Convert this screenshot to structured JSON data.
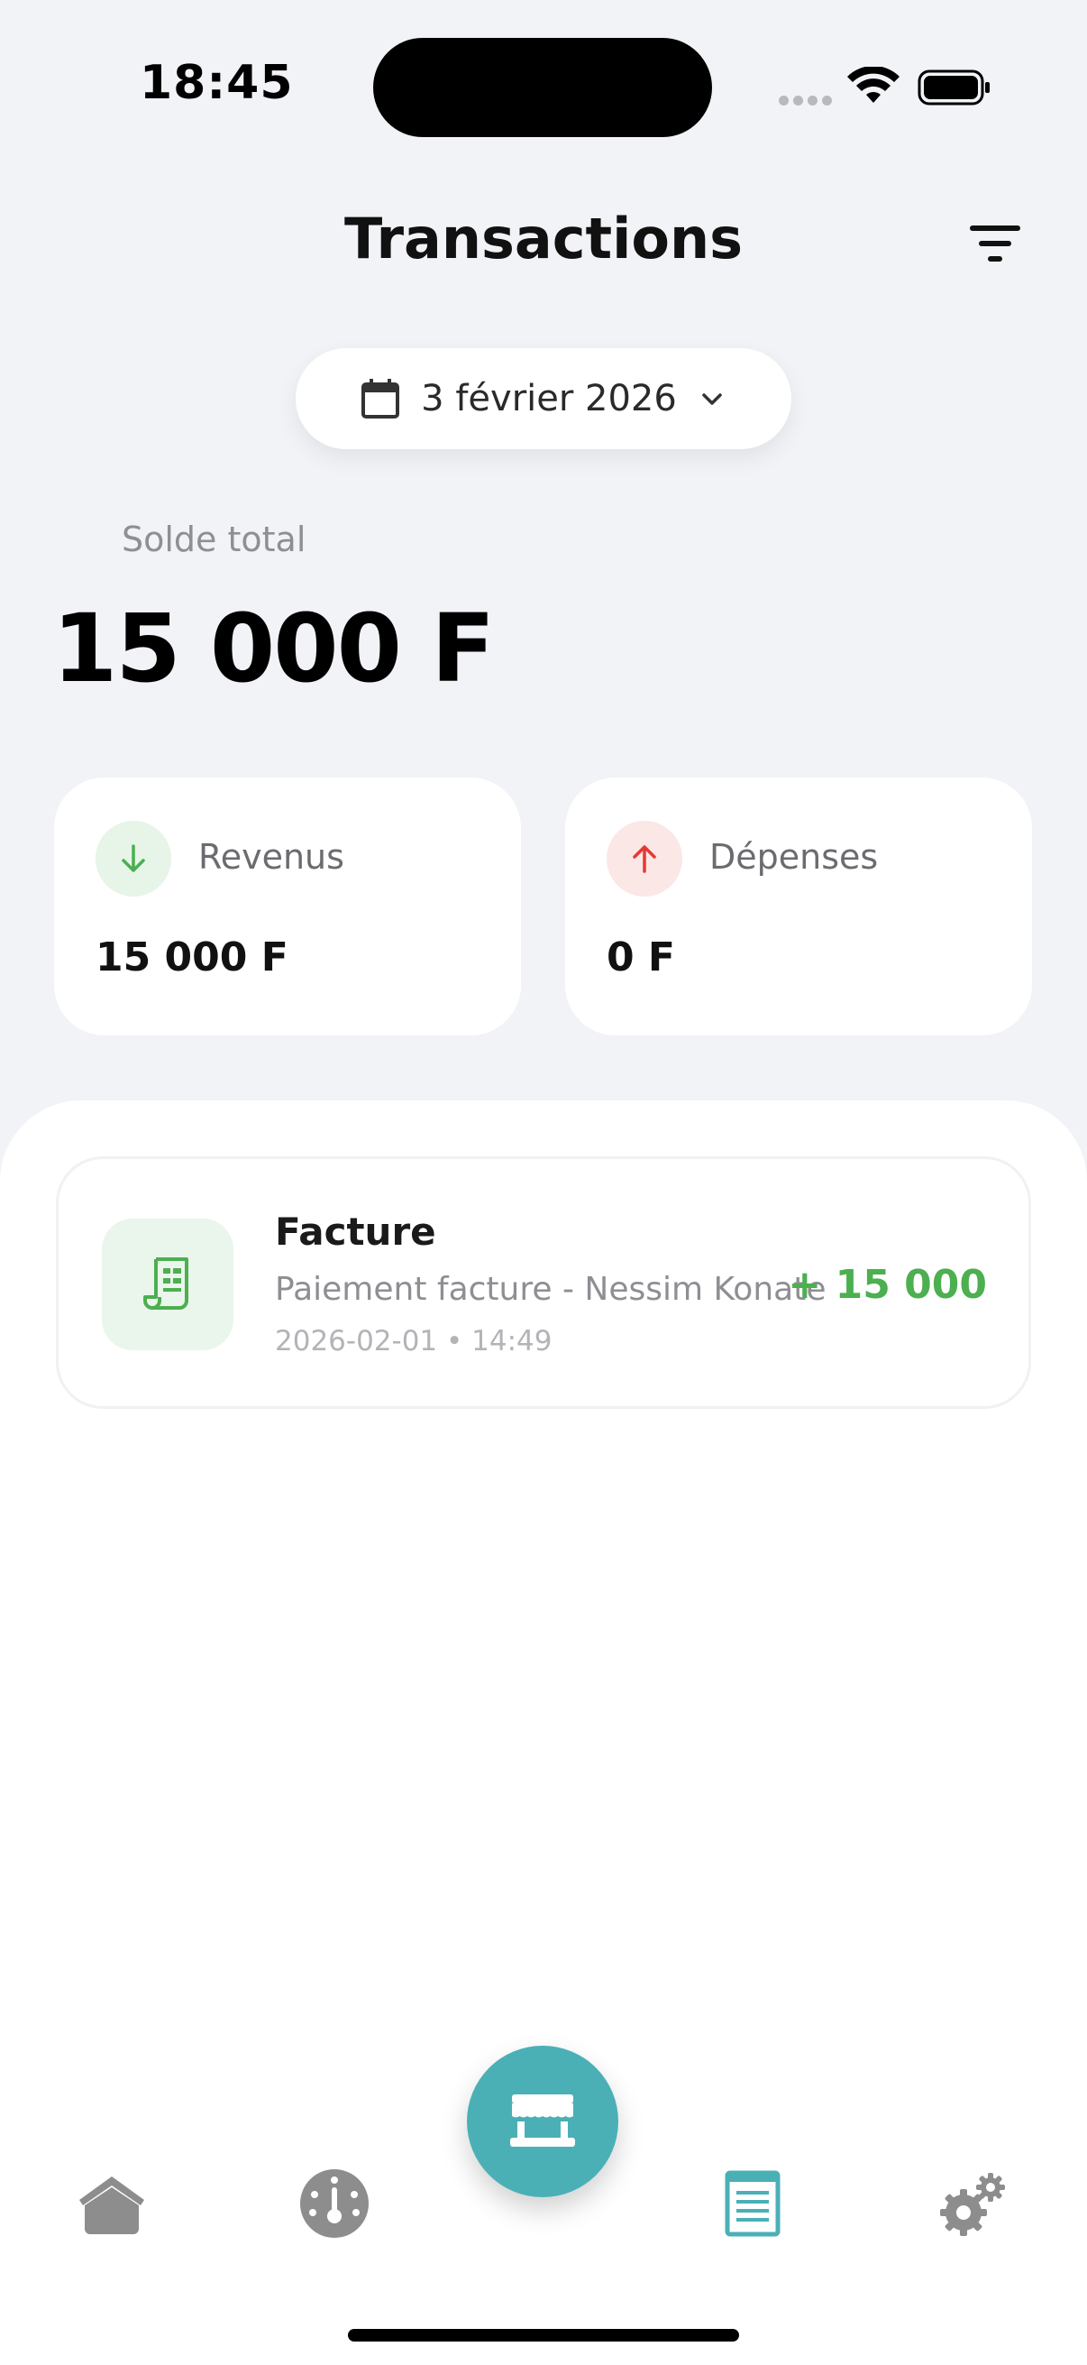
{
  "status_bar": {
    "time": "18:45"
  },
  "header": {
    "title": "Transactions"
  },
  "date_selector": {
    "label": "3 février 2026"
  },
  "balance": {
    "label": "Solde total",
    "amount": "15 000 F"
  },
  "summary": {
    "income": {
      "label": "Revenus",
      "value": "15 000 F",
      "color": "#4caf50"
    },
    "expense": {
      "label": "Dépenses",
      "value": "0 F",
      "color": "#e53935"
    }
  },
  "transactions": [
    {
      "title": "Facture",
      "description": "Paiement facture - Nessim Konate",
      "datetime": "2026-02-01 • 14:49",
      "amount": "+ 15 000",
      "icon": "receipt-icon"
    }
  ],
  "nav": {
    "items": [
      "home-icon",
      "dashboard-icon",
      "store-icon",
      "transactions-icon",
      "settings-icon"
    ],
    "accent": "#4ab0b6",
    "active": "transactions"
  }
}
